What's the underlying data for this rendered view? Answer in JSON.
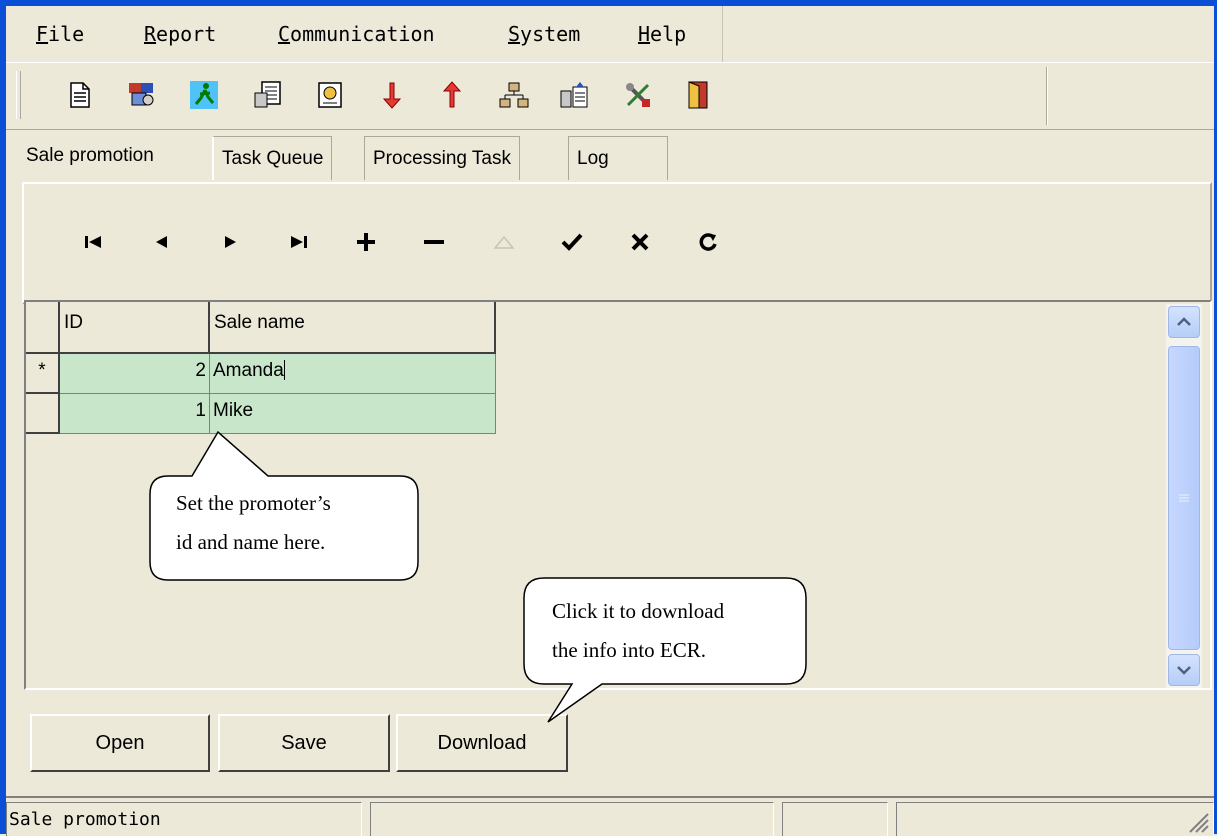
{
  "menu": {
    "items": [
      {
        "label": "File"
      },
      {
        "label": "Report"
      },
      {
        "label": "Communication"
      },
      {
        "label": "System"
      },
      {
        "label": "Help"
      }
    ]
  },
  "toolbar": {
    "icons": [
      "document-icon",
      "palette-icon",
      "running-man-icon",
      "document-list-icon",
      "certificate-icon",
      "arrow-down-icon",
      "arrow-up-icon",
      "network-icon",
      "database-upload-icon",
      "tools-icon",
      "exit-door-icon"
    ]
  },
  "tabs": [
    {
      "label": "Sale promotion",
      "active": true
    },
    {
      "label": "Task Queue"
    },
    {
      "label": "Processing Task"
    },
    {
      "label": "Log"
    }
  ],
  "navigator": {
    "buttons": [
      "first",
      "prior",
      "next",
      "last",
      "insert",
      "delete",
      "edit",
      "post",
      "cancel",
      "refresh"
    ]
  },
  "grid": {
    "columns": [
      "ID",
      "Sale name"
    ],
    "rows": [
      {
        "indicator": "*",
        "id": "2",
        "name": "Amanda"
      },
      {
        "indicator": "",
        "id": "1",
        "name": "Mike"
      }
    ],
    "row_color": "#c8e6c9"
  },
  "buttons": {
    "open": "Open",
    "save": "Save",
    "download": "Download"
  },
  "callouts": {
    "promoter": [
      "Set the promoter’s",
      "id and name here."
    ],
    "download": [
      "Click it to download",
      "the info into ECR."
    ]
  },
  "status": {
    "panel1": "Sale promotion"
  },
  "colors": {
    "window_border": "#0a4fd6",
    "face": "#ece9d8"
  }
}
